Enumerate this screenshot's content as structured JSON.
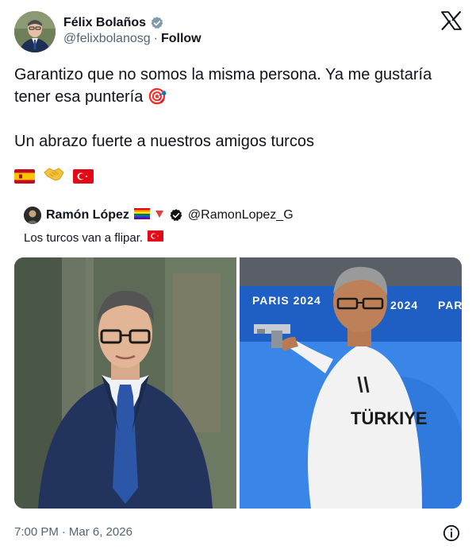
{
  "author": {
    "name": "Félix Bolaños",
    "handle": "@felixbolanosg",
    "separator": "·",
    "follow_label": "Follow",
    "avatar_icon": "avatar-felix-bolanos",
    "verified_icon": "verified-badge-icon"
  },
  "platform_logo_icon": "x-logo-icon",
  "tweet": {
    "line1": "Garantizo que no somos la misma persona. Ya me gustaría tener esa puntería 🎯",
    "line2": "Un abrazo fuerte a nuestros amigos turcos",
    "emojis": [
      "spain-flag-icon",
      "handshake-icon",
      "turkey-flag-icon"
    ]
  },
  "quote": {
    "name": "Ramón López",
    "handle": "@RamonLopez_G",
    "name_emojis": [
      "rainbow-flag-icon",
      "red-triangle-icon",
      "verified-badge-icon"
    ],
    "text": "Los turcos van a flipar.",
    "text_emoji": "turkey-flag-icon",
    "media": {
      "left_alt": "photo-man-in-suit",
      "right_alt": "photo-olympic-shooter",
      "right_banner_texts": [
        "PARIS 2024",
        "2024",
        "PAR"
      ],
      "right_shirt_text": "TÜRKIYE"
    }
  },
  "footer": {
    "time": "7:00 PM",
    "separator": "·",
    "date": "Mar 6, 2026",
    "info_icon": "info-icon"
  },
  "colors": {
    "text": "#0f1419",
    "secondary": "#536471",
    "verified": "#829aab",
    "shooting_blue": "#1e63c9"
  }
}
